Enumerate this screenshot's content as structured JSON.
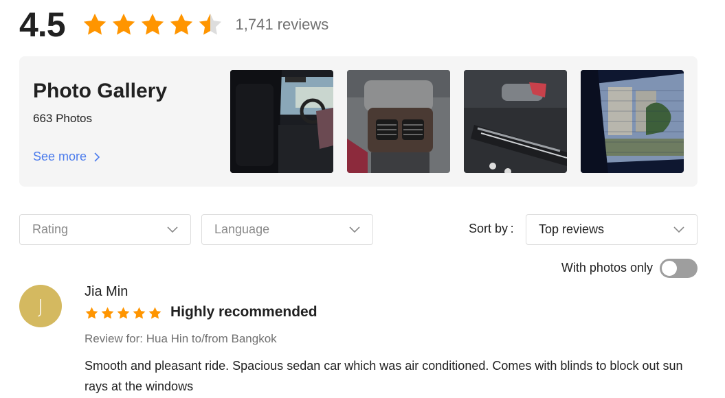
{
  "summary": {
    "score": "4.5",
    "rating_stars": 4.5,
    "review_count": "1,741 reviews"
  },
  "gallery": {
    "title": "Photo Gallery",
    "count": "663 Photos",
    "see_more": "See more",
    "photos": [
      "car-interior-front-seat",
      "rear-air-vents",
      "door-handle-panel",
      "window-with-blinds"
    ]
  },
  "filters": {
    "rating": "Rating",
    "language": "Language",
    "sort_label": "Sort by :",
    "sort_value": "Top reviews",
    "photos_only": "With photos only",
    "photos_only_enabled": false
  },
  "review": {
    "avatar_letter": "J",
    "name": "Jia Min",
    "stars": 5,
    "title": "Highly recommended",
    "review_for": "Review for: Hua Hin to/from Bangkok",
    "text": "Smooth and pleasant ride. Spacious sedan car which was air conditioned. Comes with blinds to block out sun rays at the windows"
  },
  "colors": {
    "star": "#ff9500",
    "star_empty": "#dddddd",
    "link": "#4b7bec",
    "avatar": "#d4b960",
    "toggle_off": "#9e9e9e"
  }
}
